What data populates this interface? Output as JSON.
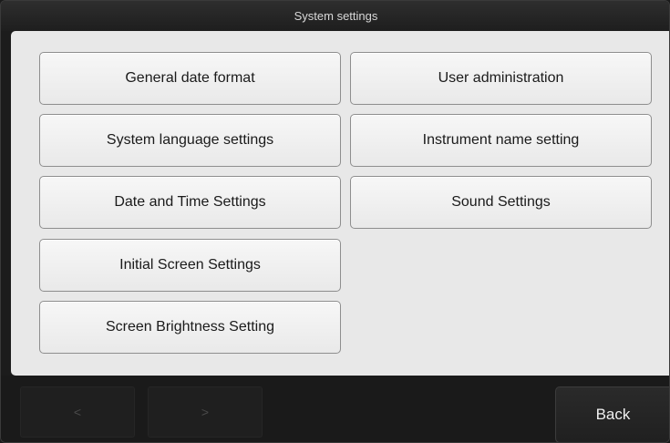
{
  "window": {
    "title": "System settings"
  },
  "settings": {
    "left": [
      "General date format",
      "System language settings",
      "Date and Time Settings",
      "Initial Screen Settings",
      "Screen Brightness Setting"
    ],
    "right": [
      "User administration",
      "Instrument name setting",
      "Sound Settings"
    ]
  },
  "navigation": {
    "prev_label": "<",
    "next_label": ">",
    "back_label": "Back"
  }
}
